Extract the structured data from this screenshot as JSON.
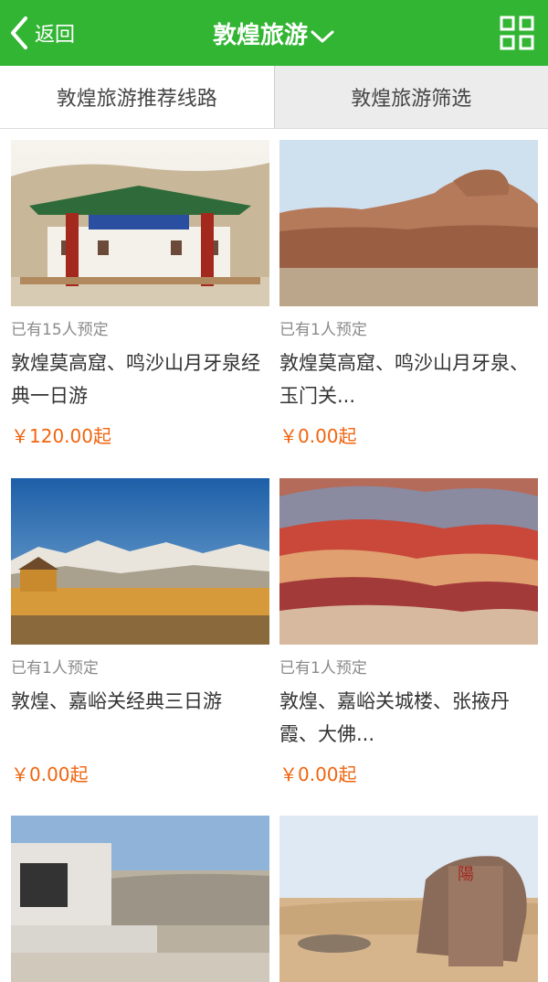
{
  "header": {
    "back_label": "返回",
    "title": "敦煌旅游"
  },
  "tabs": [
    {
      "label": "敦煌旅游推荐线路",
      "active": true
    },
    {
      "label": "敦煌旅游筛选",
      "active": false
    }
  ],
  "products": [
    {
      "booked": "已有15人预定",
      "name": "敦煌莫高窟、鸣沙山月牙泉经典一日游",
      "price": "￥120.00起"
    },
    {
      "booked": "已有1人预定",
      "name": "敦煌莫高窟、鸣沙山月牙泉、玉门关...",
      "price": "￥0.00起"
    },
    {
      "booked": "已有1人预定",
      "name": "敦煌、嘉峪关经典三日游",
      "price": "￥0.00起"
    },
    {
      "booked": "已有1人预定",
      "name": "敦煌、嘉峪关城楼、张掖丹霞、大佛...",
      "price": "￥0.00起"
    }
  ],
  "colors": {
    "header_bg": "#33b534",
    "price": "#f0650f"
  },
  "icons": [
    "chevron-left-icon",
    "chevron-down-icon",
    "grid-icon"
  ]
}
